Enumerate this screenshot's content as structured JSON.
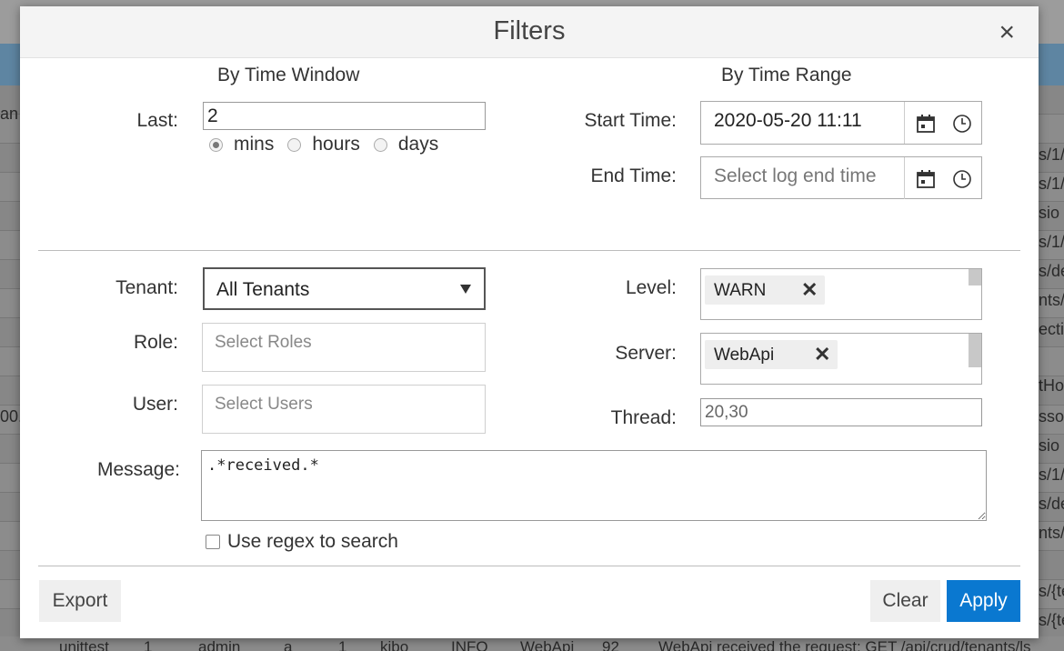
{
  "dialog": {
    "title": "Filters",
    "close_glyph": "×"
  },
  "time_window": {
    "heading": "By Time Window",
    "last_label": "Last:",
    "last_value": "2",
    "units": [
      {
        "label": "mins",
        "checked": true
      },
      {
        "label": "hours",
        "checked": false
      },
      {
        "label": "days",
        "checked": false
      }
    ]
  },
  "time_range": {
    "heading": "By Time Range",
    "start_label": "Start Time:",
    "start_value": "2020-05-20 11:11",
    "end_label": "End Time:",
    "end_placeholder": "Select log end time",
    "calendar_icon": "calendar-icon",
    "clock_icon": "clock-icon"
  },
  "tenant": {
    "label": "Tenant:",
    "selected": "All Tenants"
  },
  "role": {
    "label": "Role:",
    "placeholder": "Select Roles"
  },
  "user": {
    "label": "User:",
    "placeholder": "Select Users"
  },
  "level": {
    "label": "Level:",
    "tags": [
      "WARN"
    ]
  },
  "server": {
    "label": "Server:",
    "tags": [
      "WebApi"
    ]
  },
  "thread": {
    "label": "Thread:",
    "value": "20,30"
  },
  "message": {
    "label": "Message:",
    "value": ".*received.*"
  },
  "regex": {
    "label": "Use regex to search",
    "checked": false
  },
  "buttons": {
    "export": "Export",
    "clear": "Clear",
    "apply": "Apply"
  },
  "tag_remove_glyph": "✕",
  "colors": {
    "apply_bg": "#0a78d0",
    "header_bg": "#f4f4f4",
    "overlay_band": "#5e85a2"
  },
  "background": {
    "left_fragments": [
      "an",
      "00."
    ],
    "right_fragments": [
      "s/1/",
      "s/1/",
      "sio",
      "s/1/",
      "s/de",
      "nts/",
      "ecti",
      "tHo",
      "sso/",
      "sio",
      "s/1/",
      "s/de",
      "nts/",
      "s/{te",
      "s/{te"
    ],
    "bottom_row": [
      "unittest",
      "1",
      "admin",
      "a",
      "1",
      "kibo",
      "INFO",
      "WebApi",
      "92",
      "WebApi received the request: GET /api/crud/tenants/ls"
    ]
  }
}
